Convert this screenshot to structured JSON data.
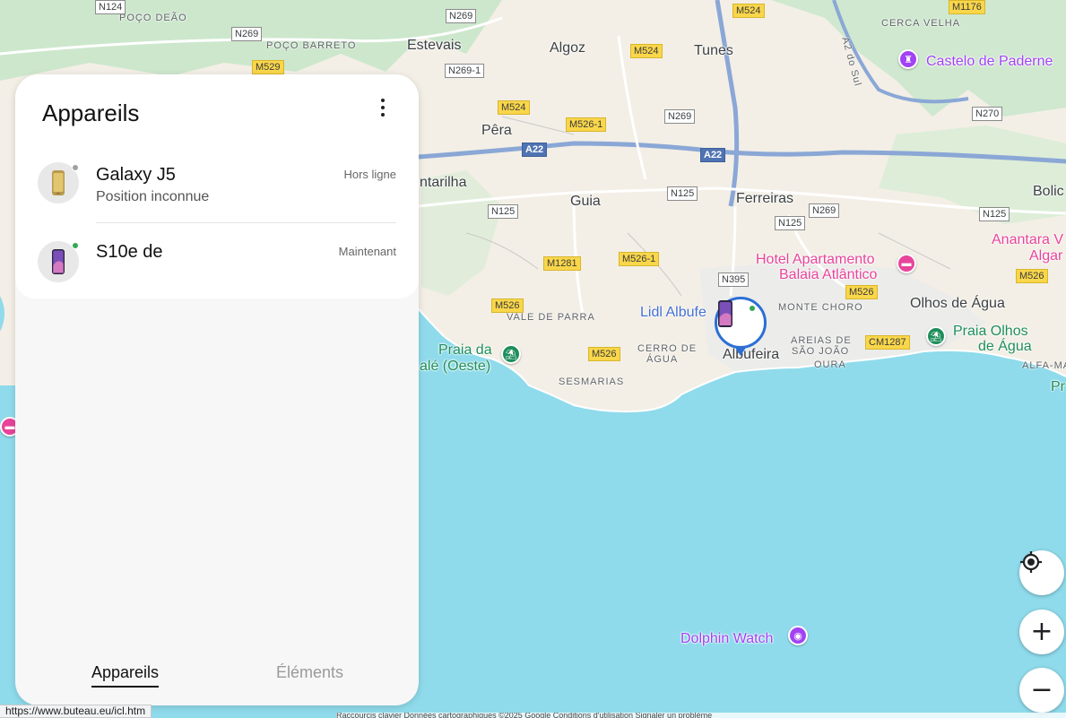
{
  "panel": {
    "title": "Appareils",
    "more_icon": "more-vertical-icon",
    "devices": [
      {
        "name": "Galaxy J5",
        "subtitle": "Position inconnue",
        "time": "Hors ligne",
        "status_color": "#a0a0a0",
        "icon": "phone-gold-icon"
      },
      {
        "name": "S10e de",
        "subtitle": "",
        "time": "Maintenant",
        "status_color": "#34a853",
        "icon": "phone-purple-icon"
      }
    ],
    "tabs": [
      {
        "label": "Appareils",
        "active": true
      },
      {
        "label": "Éléments",
        "active": false
      }
    ]
  },
  "map": {
    "places_large": [
      "Estevais",
      "Algoz",
      "Tunes",
      "Pêra",
      "Guia",
      "Ferreiras",
      "Olhos de Água",
      "ntarilha",
      "Bolic",
      "Albufeira"
    ],
    "places_small": [
      "POÇO DEÃO",
      "POÇO BARRETO",
      "CERCA VELHA",
      "VALE DE PARRA",
      "CERRO DE",
      "ÁGUA",
      "SESMARIAS",
      "MONTE CHORO",
      "AREIAS DE",
      "SÃO JOÃO",
      "OURA",
      "ALFA-MA",
      "A2 do Sul"
    ],
    "pois": [
      {
        "label": "Castelo de Paderne",
        "color": "#a142f4",
        "icon": "castle-icon"
      },
      {
        "label_line1": "Hotel Apartamento",
        "label_line2": "Balaia Atlântico",
        "color": "#e8449a",
        "icon": "hotel-icon"
      },
      {
        "label_line1": "Anantara V",
        "label_line2": "Algar",
        "color": "#e8449a"
      },
      {
        "label": "Lidl Albufe",
        "color": "#4470d4"
      },
      {
        "label_line1": "Praia da",
        "label_line2": "alé (Oeste)",
        "color": "#1e8e5a",
        "icon": "beach-icon"
      },
      {
        "label_line1": "Praia Olhos",
        "label_line2": "de Água",
        "color": "#1e8e5a",
        "icon": "beach-icon"
      },
      {
        "label": "Dolphin Watch",
        "color": "#a142f4",
        "icon": "camera-icon"
      },
      {
        "label": "Pr",
        "color": "#1e8e5a"
      }
    ],
    "roads": [
      "N269",
      "N269",
      "N269-1",
      "N269",
      "N269",
      "N125",
      "N125",
      "N125",
      "N125",
      "N125",
      "N395",
      "N270",
      "M524",
      "M524",
      "M524",
      "M526-1",
      "M526-1",
      "M529",
      "M1281",
      "M526",
      "M526",
      "M526",
      "M526",
      "M1176",
      "CM1287",
      "A22",
      "A22",
      "N125"
    ],
    "controls": {
      "locate_icon": "my-location-icon",
      "zoom_in": "+",
      "zoom_out": "−"
    },
    "attribution": "Raccourcis clavier   Données cartographiques ©2025 Google   Conditions d'utilisation   Signaler un problème"
  },
  "status_url": "https://www.buteau.eu/icl.htm",
  "colors": {
    "water": "#8fdbec",
    "land": "#f3efe6",
    "green": "#cfe8cf",
    "highway": "#8aa7d6",
    "marker": "#2b6fd6"
  }
}
